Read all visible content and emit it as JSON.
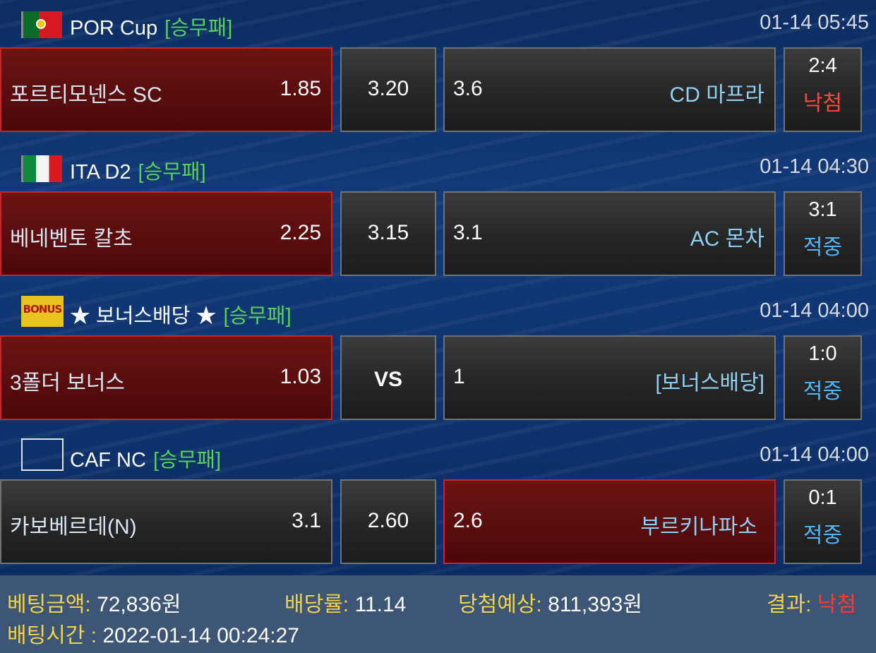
{
  "matches": [
    {
      "flag_icon": "portugal-flag-icon",
      "league": "POR Cup",
      "bet_type": "[승무패]",
      "datetime": "01-14 05:45",
      "home_team": "포르티모넨스 SC",
      "home_odds": "1.85",
      "draw_odds": "3.20",
      "away_odds": "3.6",
      "away_team": "CD 마프라",
      "score": "2:4",
      "result": "낙첨",
      "selected": "home"
    },
    {
      "flag_icon": "italy-flag-icon",
      "league": "ITA D2",
      "bet_type": "[승무패]",
      "datetime": "01-14 04:30",
      "home_team": "베네벤토 칼초",
      "home_odds": "2.25",
      "draw_odds": "3.15",
      "away_odds": "3.1",
      "away_team": "AC 몬차",
      "score": "3:1",
      "result": "적중",
      "selected": "home"
    },
    {
      "flag_icon": "bonus-badge-icon",
      "flag_text": "BONUS",
      "league": "★ 보너스배당 ★",
      "bet_type": "[승무패]",
      "datetime": "01-14 04:00",
      "home_team": "3폴더 보너스",
      "home_odds": "1.03",
      "draw_odds": "VS",
      "away_odds": "1",
      "away_team": "[보너스배당]",
      "score": "1:0",
      "result": "적중",
      "selected": "home"
    },
    {
      "flag_icon": "blank-flag-icon",
      "league": "CAF NC",
      "bet_type": "[승무패]",
      "datetime": "01-14 04:00",
      "home_team": "카보베르데(N)",
      "home_odds": "3.1",
      "draw_odds": "2.60",
      "away_odds": "2.6",
      "away_team": "부르키나파소",
      "score": "0:1",
      "result": "적중",
      "selected": "away"
    }
  ],
  "summary": {
    "bet_amount_label": "베팅금액:",
    "bet_amount_value": "72,836원",
    "odds_label": "배당률:",
    "odds_value": "11.14",
    "expected_label": "당첨예상:",
    "expected_value": "811,393원",
    "result_label": "결과:",
    "result_value": "낙첨",
    "bet_time_label": "배팅시간 :",
    "bet_time_value": "2022-01-14 00:24:27"
  },
  "colors": {
    "selected_bg": "#5a0d0d",
    "lose": "#ff4a3c",
    "hit": "#4fb6ff",
    "tag": "#58d05a"
  }
}
